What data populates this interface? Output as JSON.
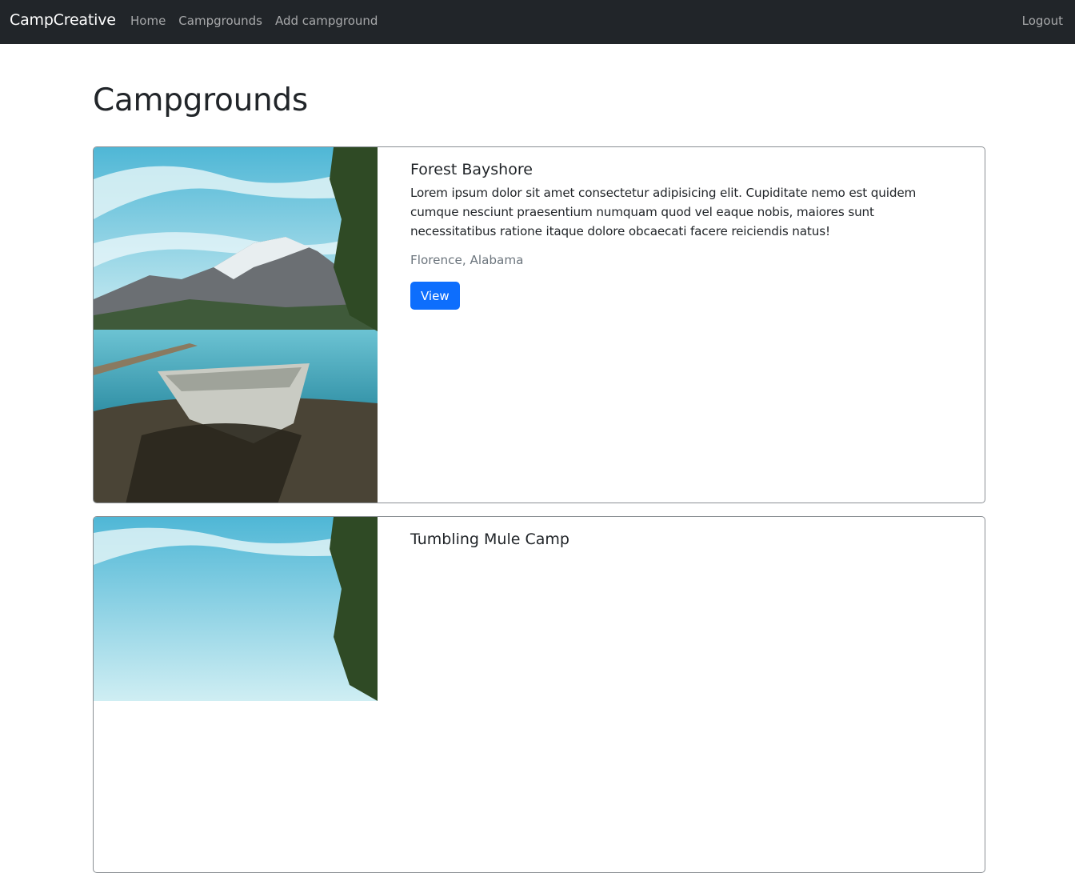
{
  "navbar": {
    "brand": "CampCreative",
    "links": [
      {
        "label": "Home"
      },
      {
        "label": "Campgrounds"
      },
      {
        "label": "Add campground"
      }
    ],
    "logout": "Logout",
    "bg_color": "#212529"
  },
  "main": {
    "title": "Campgrounds",
    "campgrounds": [
      {
        "name": "Forest Bayshore",
        "description": "Lorem ipsum dolor sit amet consectetur adipisicing elit. Cupiditate nemo est quidem cumque nesciunt praesentium numquam quod vel eaque nobis, maiores sunt necessitatibus ratione itaque dolore obcaecati facere reiciendis natus!",
        "location": "Florence, Alabama",
        "button_label": "View",
        "image": "lake-mountain-boat-photo"
      },
      {
        "name": "Tumbling Mule Camp",
        "image": "lake-mountain-boat-photo"
      }
    ]
  },
  "colors": {
    "primary": "#0d6efd",
    "muted": "#6c757d"
  }
}
